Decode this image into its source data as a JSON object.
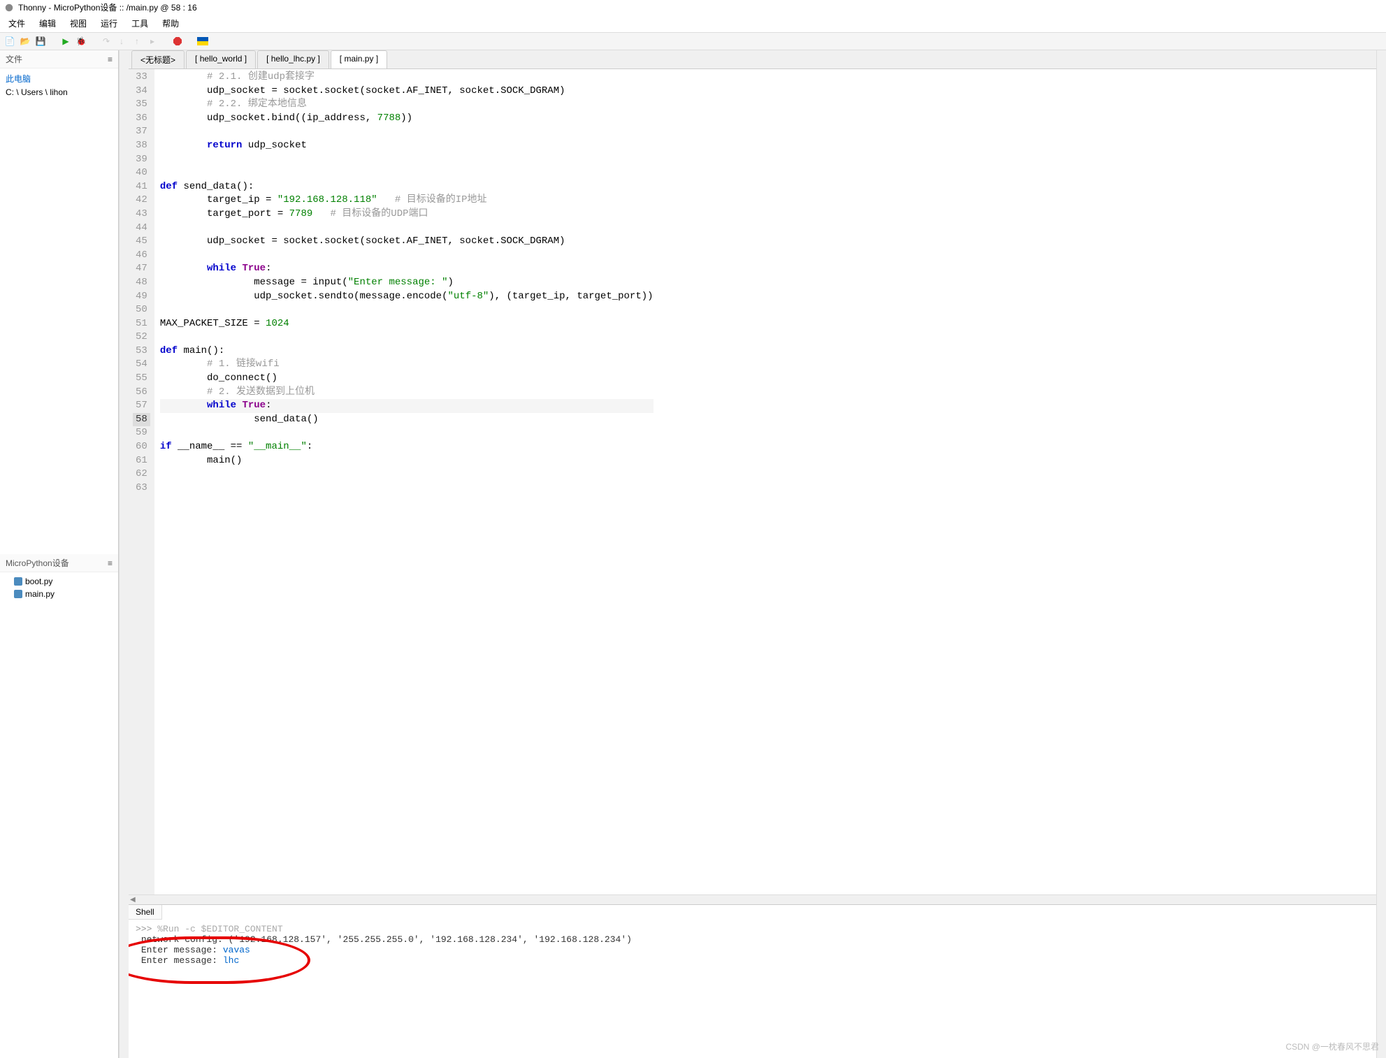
{
  "title": "Thonny  -  MicroPython设备 :: /main.py  @  58 : 16",
  "menu": [
    "文件",
    "编辑",
    "视图",
    "运行",
    "工具",
    "帮助"
  ],
  "files_panel": {
    "header": "文件",
    "computer": "此电脑",
    "path": "C: \\ Users \\ lihon"
  },
  "device_panel": {
    "header": "MicroPython设备",
    "files": [
      "boot.py",
      "main.py"
    ]
  },
  "tabs": [
    "<无标题>",
    "[ hello_world ]",
    "[ hello_lhc.py ]",
    "[ main.py ]"
  ],
  "active_tab": 3,
  "line_start": 33,
  "active_line": 58,
  "code": [
    {
      "n": 33,
      "i": 2,
      "cmt": "# 2.1. 创建udp套接字"
    },
    {
      "n": 34,
      "i": 0,
      "raw": "<span class='cmt'></span>"
    },
    {
      "n": 35,
      "i": 2,
      "raw": "udp_socket = socket.socket(socket.AF_INET, socket.SOCK_DGRAM)"
    },
    {
      "n": 36,
      "i": 2,
      "cmt": "# 2.2. 绑定本地信息"
    },
    {
      "n": 37,
      "i": 2,
      "raw": "udp_socket.bind((ip_address, <span class='num'>7788</span>))"
    },
    {
      "n": 38,
      "i": 0,
      "raw": ""
    },
    {
      "n": 39,
      "i": 2,
      "raw": "<span class='kw'>return</span> udp_socket"
    },
    {
      "n": 40,
      "i": 0,
      "raw": ""
    },
    {
      "n": 41,
      "i": 0,
      "raw": ""
    },
    {
      "n": 42,
      "i": 0,
      "raw": "<span class='kw'>def</span> <span class='fn'>send_data</span>():"
    },
    {
      "n": 43,
      "i": 2,
      "raw": "target_ip = <span class='str'>\"192.168.128.118\"</span>   <span class='cmt'># 目标设备的IP地址</span>"
    },
    {
      "n": 44,
      "i": 2,
      "raw": "target_port = <span class='num'>7789</span>   <span class='cmt'># 目标设备的UDP端口</span>"
    },
    {
      "n": 45,
      "i": 0,
      "raw": ""
    },
    {
      "n": 46,
      "i": 2,
      "raw": "udp_socket = socket.socket(socket.AF_INET, socket.SOCK_DGRAM)"
    },
    {
      "n": 47,
      "i": 0,
      "raw": ""
    },
    {
      "n": 48,
      "i": 2,
      "raw": "<span class='kw'>while</span> <span class='kw2'>True</span>:"
    },
    {
      "n": 49,
      "i": 4,
      "raw": "message = input(<span class='str'>\"Enter message: \"</span>)"
    },
    {
      "n": 50,
      "i": 4,
      "raw": "udp_socket.sendto(message.encode(<span class='str'>\"utf-8\"</span>), (target_ip, target_port))"
    },
    {
      "n": 51,
      "i": 0,
      "raw": ""
    },
    {
      "n": 52,
      "i": 0,
      "raw": "MAX_PACKET_SIZE = <span class='num'>1024</span>"
    },
    {
      "n": 53,
      "i": 0,
      "raw": ""
    },
    {
      "n": 54,
      "i": 0,
      "raw": "<span class='kw'>def</span> <span class='fn'>main</span>():"
    },
    {
      "n": 55,
      "i": 2,
      "cmt": "# 1. 链接wifi"
    },
    {
      "n": 56,
      "i": 2,
      "raw": "do_connect()"
    },
    {
      "n": 57,
      "i": 2,
      "cmt": "# 2. 发送数据到上位机"
    },
    {
      "n": 58,
      "i": 2,
      "raw": "<span class='kw'>while</span> <span class='kw2'>True</span>:",
      "hl": true
    },
    {
      "n": 59,
      "i": 4,
      "raw": "send_data()"
    },
    {
      "n": 60,
      "i": 0,
      "raw": ""
    },
    {
      "n": 61,
      "i": 0,
      "raw": "<span class='kw'>if</span> __name__ == <span class='str'>\"__main__\"</span>:"
    },
    {
      "n": 62,
      "i": 2,
      "raw": "main()"
    },
    {
      "n": 63,
      "i": 0,
      "raw": ""
    }
  ],
  "shell": {
    "tab": "Shell",
    "prompt": ">>> ",
    "cmd": "%Run -c $EDITOR_CONTENT",
    "lines": [
      {
        "out": "network config: ('192.168.128.157', '255.255.255.0', '192.168.128.234', '192.168.128.234')"
      },
      {
        "out": "Enter message: ",
        "inp": "vavas"
      },
      {
        "out": "Enter message: ",
        "inp": "lhc"
      }
    ]
  },
  "watermark": "CSDN @一枕春风不思君"
}
